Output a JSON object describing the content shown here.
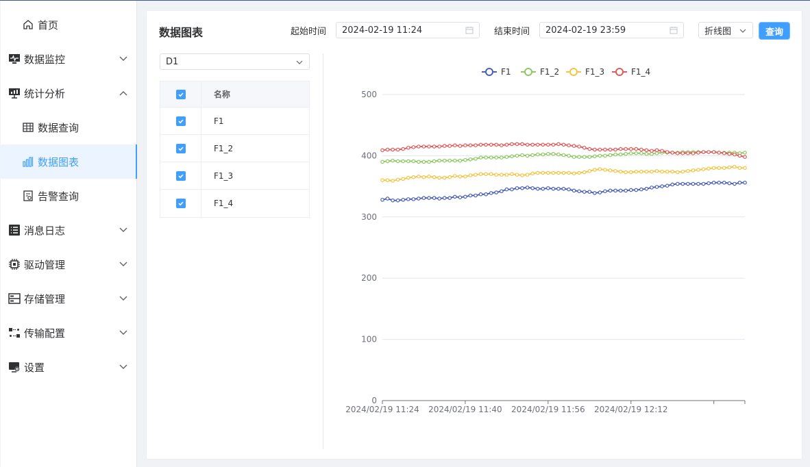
{
  "sidebar": {
    "items": [
      {
        "label": "首页",
        "icon": "home-icon"
      },
      {
        "label": "数据监控",
        "icon": "monitor-icon"
      },
      {
        "label": "统计分析",
        "icon": "presentation-chart-icon"
      },
      {
        "label": "数据查询",
        "icon": "table-grid-icon"
      },
      {
        "label": "数据图表",
        "icon": "bar-chart-icon"
      },
      {
        "label": "告警查询",
        "icon": "alarm-doc-icon"
      },
      {
        "label": "消息日志",
        "icon": "list-icon"
      },
      {
        "label": "驱动管理",
        "icon": "chip-icon"
      },
      {
        "label": "存储管理",
        "icon": "storage-icon"
      },
      {
        "label": "传输配置",
        "icon": "transfer-icon"
      },
      {
        "label": "设置",
        "icon": "settings-monitor-icon"
      }
    ]
  },
  "main": {
    "title": "数据图表",
    "start_label": "起始时间",
    "start_value": "2024-02-19 11:24",
    "end_label": "结束时间",
    "end_value": "2024-02-19 23:59",
    "chart_type_value": "折线图",
    "query_label": "查询",
    "device_value": "D1",
    "table": {
      "header": "名称",
      "rows": [
        "F1",
        "F1_2",
        "F1_3",
        "F1_4"
      ]
    }
  },
  "colors": {
    "accent": "#409eff",
    "series": [
      "#4a60b8",
      "#8fc964",
      "#f5c443",
      "#e35b5b"
    ]
  },
  "chart_data": {
    "type": "line",
    "ylim": [
      0,
      500
    ],
    "yticks": [
      0,
      100,
      200,
      300,
      400,
      500
    ],
    "xtick_labels": [
      "2024/02/19 11:24",
      "2024/02/19 11:40",
      "2024/02/19 11:56",
      "2024/02/19 12:12"
    ],
    "legend_position": "top-center",
    "grid": true,
    "series": [
      {
        "name": "F1",
        "values": [
          328,
          330,
          327,
          327,
          328,
          329,
          329,
          330,
          331,
          331,
          331,
          330,
          331,
          331,
          333,
          332,
          333,
          335,
          335,
          337,
          337,
          339,
          340,
          342,
          345,
          345,
          347,
          347,
          348,
          347,
          346,
          346,
          347,
          346,
          346,
          346,
          345,
          343,
          342,
          341,
          341,
          339,
          340,
          342,
          343,
          343,
          343,
          343,
          344,
          344,
          345,
          346,
          348,
          349,
          350,
          351,
          353,
          354,
          354,
          354,
          354,
          354,
          354,
          355,
          356,
          356,
          356,
          355,
          354,
          356,
          356
        ]
      },
      {
        "name": "F1_2",
        "values": [
          390,
          391,
          392,
          391,
          391,
          391,
          391,
          390,
          390,
          390,
          391,
          392,
          392,
          392,
          392,
          392,
          393,
          394,
          395,
          397,
          397,
          397,
          397,
          397,
          398,
          399,
          400,
          401,
          400,
          401,
          402,
          402,
          403,
          403,
          402,
          401,
          400,
          398,
          398,
          398,
          398,
          399,
          400,
          400,
          401,
          402,
          402,
          403,
          404,
          404,
          404,
          403,
          403,
          404,
          405,
          405,
          405,
          405,
          406,
          406,
          406,
          406,
          406,
          406,
          406,
          405,
          405,
          405,
          405,
          404,
          405
        ]
      },
      {
        "name": "F1_3",
        "values": [
          360,
          360,
          359,
          361,
          362,
          364,
          365,
          366,
          365,
          366,
          365,
          364,
          364,
          365,
          367,
          366,
          366,
          368,
          369,
          370,
          370,
          370,
          369,
          369,
          369,
          370,
          369,
          368,
          369,
          371,
          372,
          372,
          372,
          372,
          372,
          372,
          372,
          371,
          372,
          373,
          375,
          377,
          378,
          377,
          376,
          375,
          374,
          373,
          373,
          374,
          374,
          374,
          374,
          375,
          374,
          374,
          374,
          373,
          374,
          375,
          376,
          377,
          378,
          379,
          380,
          380,
          380,
          381,
          382,
          380,
          380
        ]
      },
      {
        "name": "F1_4",
        "values": [
          409,
          410,
          410,
          410,
          411,
          413,
          414,
          415,
          415,
          415,
          415,
          415,
          416,
          416,
          417,
          416,
          417,
          417,
          417,
          418,
          418,
          418,
          418,
          417,
          418,
          419,
          419,
          419,
          418,
          418,
          418,
          418,
          418,
          418,
          419,
          418,
          417,
          416,
          415,
          413,
          411,
          410,
          410,
          410,
          410,
          410,
          411,
          411,
          411,
          411,
          410,
          409,
          408,
          409,
          408,
          406,
          405,
          404,
          404,
          404,
          404,
          405,
          406,
          406,
          406,
          405,
          404,
          403,
          402,
          400,
          398
        ]
      }
    ]
  }
}
